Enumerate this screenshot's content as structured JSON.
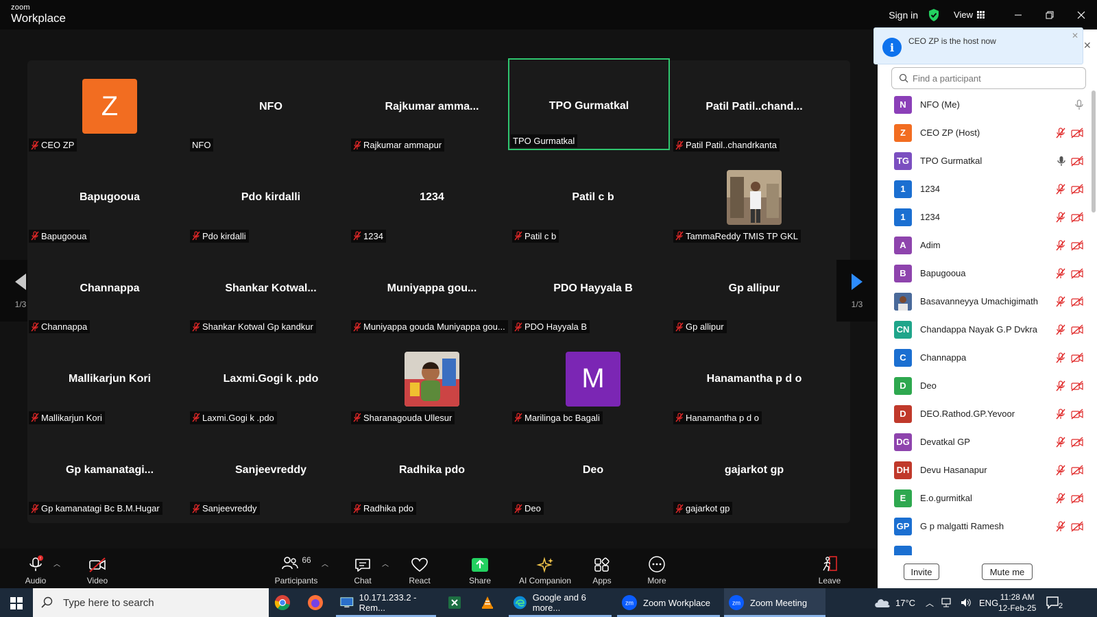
{
  "titlebar": {
    "brand_top": "zoom",
    "brand_bottom": "Workplace",
    "signin": "Sign in",
    "view": "View"
  },
  "gallery": {
    "tiles": [
      {
        "display": "",
        "avatar": "Z",
        "avatar_color": "#f26d21",
        "label": "CEO ZP",
        "muted": true
      },
      {
        "display": "NFO",
        "label": "NFO",
        "muted": false
      },
      {
        "display": "Rajkumar  amma...",
        "label": "Rajkumar ammapur",
        "muted": true
      },
      {
        "display": "TPO Gurmatkal",
        "label": "TPO Gurmatkal",
        "muted": false,
        "active": true
      },
      {
        "display": "Patil  Patil..chand...",
        "label": "Patil Patil..chandrkanta",
        "muted": true
      },
      {
        "display": "Bapugooua",
        "label": "Bapugooua",
        "muted": true
      },
      {
        "display": "Pdo kirdalli",
        "label": "Pdo kirdalli",
        "muted": true
      },
      {
        "display": "1234",
        "label": "1234",
        "muted": true
      },
      {
        "display": "Patil c b",
        "label": "Patil c b",
        "muted": true
      },
      {
        "display": "",
        "photo": "man",
        "label": "TammaReddy TMIS TP GKL",
        "muted": true
      },
      {
        "display": "Channappa",
        "label": "Channappa",
        "muted": true
      },
      {
        "display": "Shankar  Kotwal...",
        "label": "Shankar Kotwal Gp kandkur",
        "muted": true
      },
      {
        "display": "Muniyappa  gou...",
        "label": "Muniyappa gouda Muniyappa gou...",
        "muted": true
      },
      {
        "display": "PDO Hayyala B",
        "label": "PDO Hayyala B",
        "muted": true
      },
      {
        "display": "Gp allipur",
        "label": "Gp allipur",
        "muted": true
      },
      {
        "display": "Mallikarjun Kori",
        "label": "Mallikarjun Kori",
        "muted": true
      },
      {
        "display": "Laxmi.Gogi k .pdo",
        "label": "Laxmi.Gogi k .pdo",
        "muted": true
      },
      {
        "display": "",
        "photo": "child",
        "label": "Sharanagouda Ullesur",
        "muted": true
      },
      {
        "display": "",
        "avatar": "M",
        "avatar_color": "#7b26b4",
        "label": "Marilinga bc Bagali",
        "muted": true
      },
      {
        "display": "Hanamantha p d o",
        "label": "Hanamantha p d o",
        "muted": true
      },
      {
        "display": "Gp  kamanatagi...",
        "label": "Gp kamanatagi Bc B.M.Hugar",
        "muted": true
      },
      {
        "display": "Sanjeevreddy",
        "label": "Sanjeevreddy",
        "muted": true
      },
      {
        "display": "Radhika pdo",
        "label": "Radhika pdo",
        "muted": true
      },
      {
        "display": "Deo",
        "label": "Deo",
        "muted": true
      },
      {
        "display": "gajarkot gp",
        "label": "gajarkot gp",
        "muted": true
      }
    ],
    "page_left": "1/3",
    "page_right": "1/3"
  },
  "toolbar": {
    "audio": "Audio",
    "video": "Video",
    "participants": "Participants",
    "participants_count": "66",
    "chat": "Chat",
    "react": "React",
    "share": "Share",
    "ai": "AI Companion",
    "apps": "Apps",
    "more": "More",
    "leave": "Leave"
  },
  "notification": {
    "message": "CEO ZP is the host now"
  },
  "panel": {
    "search_placeholder": "Find a participant",
    "participants": [
      {
        "initials": "N",
        "color": "#8b3fb8",
        "name": "NFO (Me)",
        "mic": "on-gray",
        "video": false
      },
      {
        "initials": "Z",
        "color": "#f26d21",
        "name": "CEO ZP (Host)",
        "mic": "muted",
        "video": true
      },
      {
        "initials": "TG",
        "color": "#7b4fc0",
        "name": "TPO Gurmatkal",
        "mic": "on",
        "video": true
      },
      {
        "initials": "1",
        "color": "#1b6fd1",
        "name": "1234",
        "mic": "muted",
        "video": true
      },
      {
        "initials": "1",
        "color": "#1b6fd1",
        "name": "1234",
        "mic": "muted",
        "video": true
      },
      {
        "initials": "A",
        "color": "#8e44ad",
        "name": "Adim",
        "mic": "muted",
        "video": true
      },
      {
        "initials": "B",
        "color": "#8e44ad",
        "name": "Bapugooua",
        "mic": "muted",
        "video": true
      },
      {
        "initials": "",
        "color": "#3a5a8a",
        "name": "Basavanneyya Umachigimath",
        "mic": "muted",
        "video": true,
        "photo": true
      },
      {
        "initials": "CN",
        "color": "#1fa58a",
        "name": "Chandappa Nayak G.P Dvkra",
        "mic": "muted",
        "video": true
      },
      {
        "initials": "C",
        "color": "#1b6fd1",
        "name": "Channappa",
        "mic": "muted",
        "video": true
      },
      {
        "initials": "D",
        "color": "#2ea84f",
        "name": "Deo",
        "mic": "muted",
        "video": true
      },
      {
        "initials": "D",
        "color": "#c0392b",
        "name": "DEO.Rathod.GP.Yevoor",
        "mic": "muted",
        "video": true
      },
      {
        "initials": "DG",
        "color": "#8e44ad",
        "name": "Devatkal GP",
        "mic": "muted",
        "video": true
      },
      {
        "initials": "DH",
        "color": "#c0392b",
        "name": "Devu Hasanapur",
        "mic": "muted",
        "video": true
      },
      {
        "initials": "E",
        "color": "#2ea84f",
        "name": "E.o.gurmitkal",
        "mic": "muted",
        "video": true
      },
      {
        "initials": "GP",
        "color": "#1b6fd1",
        "name": "G p malgatti Ramesh",
        "mic": "muted",
        "video": true
      }
    ],
    "invite": "Invite",
    "mute_me": "Mute me"
  },
  "taskbar": {
    "search_placeholder": "Type here to search",
    "apps": [
      {
        "label": "10.171.233.2 - Rem..."
      },
      {
        "label": "Google and 6 more..."
      },
      {
        "label": "Zoom Workplace"
      },
      {
        "label": "Zoom Meeting"
      }
    ],
    "weather": "17°C",
    "lang": "ENG",
    "time": "11:28 AM",
    "date": "12-Feb-25",
    "notif_count": "2"
  }
}
